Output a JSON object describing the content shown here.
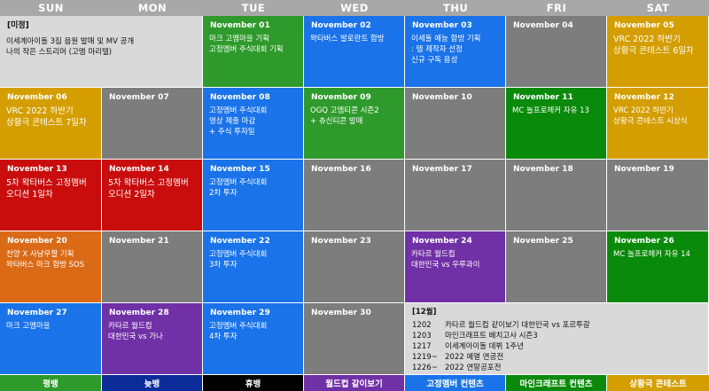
{
  "days": [
    "SUN",
    "MON",
    "TUE",
    "WED",
    "THU",
    "FRI",
    "SAT"
  ],
  "week1": {
    "sun_mon": {
      "label": "[미정]",
      "text": "이세계아이돌 3집 음원 발매 및 MV 공개\n나의 작은 스트리머 (고멤 마리텔)"
    },
    "tue": {
      "date": "November 01",
      "text": "마크 고멤마을 기획\n고정멤버 주식대회 기획"
    },
    "wed": {
      "date": "November 02",
      "text": "왁타버스 발로란트 합방"
    },
    "thu": {
      "date": "November 03",
      "text": "이세돌 예능 합방 기획\n: 템 제작자 선정\n신규 구독 용성"
    },
    "fri": {
      "date": "November 04",
      "text": ""
    },
    "sat": {
      "date": "November 05",
      "text": "VRC 2022 하반기\n상황극 콘테스트 6일차"
    }
  },
  "week2": {
    "sun": {
      "date": "November 06",
      "text": "VRC 2022 하반기\n상황극 콘테스트 7일차"
    },
    "mon": {
      "date": "November 07",
      "text": ""
    },
    "tue": {
      "date": "November 08",
      "text": "고정멤버 주식대회\n영상 제출 마감\n+ 주식 투자일"
    },
    "wed": {
      "date": "November 09",
      "text": "OGQ 고멤티콘 시즌2\n+ 츄신티콘 발매"
    },
    "thu": {
      "date": "November 10",
      "text": ""
    },
    "fri": {
      "date": "November 11",
      "text": "MC 놀프로헤커 자유 13"
    },
    "sat": {
      "date": "November 12",
      "text": "VRC 2022 하반기\n상황극 콘테스트 시상식"
    }
  },
  "week3": {
    "sun": {
      "date": "November 13",
      "text": "5차 왁타버스 고정멤버\n오디션 1일차"
    },
    "mon": {
      "date": "November 14",
      "text": "5차 왁타버스 고정멤버\n오디션 2일차"
    },
    "tue": {
      "date": "November 15",
      "text": "고정멤버 주식대회\n2차 투자"
    },
    "wed": {
      "date": "November 16",
      "text": ""
    },
    "thu": {
      "date": "November 17",
      "text": ""
    },
    "fri": {
      "date": "November 18",
      "text": ""
    },
    "sat": {
      "date": "November 19",
      "text": ""
    }
  },
  "week4": {
    "sun": {
      "date": "November 20",
      "text": "천양 X 사냥우짤 기획\n왁타버스 마크 합방 SOS"
    },
    "mon": {
      "date": "November 21",
      "text": ""
    },
    "tue": {
      "date": "November 22",
      "text": "고정멤버 주식대회\n3차 투자"
    },
    "wed": {
      "date": "November 23",
      "text": ""
    },
    "thu": {
      "date": "November 24",
      "text": "카타르 월드컵\n대한민국 vs 우루과이"
    },
    "fri": {
      "date": "November 25",
      "text": ""
    },
    "sat": {
      "date": "November 26",
      "text": "MC 놀프로헤커 자유 14"
    }
  },
  "week5": {
    "sun": {
      "date": "November 27",
      "text": "마크 고멤마을"
    },
    "mon": {
      "date": "November 28",
      "text": "카타르 월드컵\n대한민국 vs 가나"
    },
    "tue": {
      "date": "November 29",
      "text": "고정멤버 주식대회\n4차 투자"
    },
    "wed": {
      "date": "November 30",
      "text": ""
    }
  },
  "notes": {
    "title": "[12월]",
    "rows": [
      {
        "k": "1202",
        "v": "카타르 월드컵 같이보기 대한민국 vs 포르투갈"
      },
      {
        "k": "1203",
        "v": "마인크래프트 배치고사 시즌3"
      },
      {
        "k": "1217",
        "v": "이세계아이돌 데뷔 1주년"
      },
      {
        "k": "1219~",
        "v": "2022 예열 연공전"
      },
      {
        "k": "1226~",
        "v": "2022 연말공포전"
      }
    ]
  },
  "legend": [
    "평뱅",
    "늦뱅",
    "휴뱅",
    "월드컵 같이보기",
    "고정멤버 컨텐츠",
    "마인크래프트 컨텐츠",
    "상황극 콘테스트"
  ],
  "colors": {
    "header": "#a8a8a8",
    "gray": "#7d7d7d",
    "green": "#2e9a2b",
    "blue": "#1a73e8",
    "orange": "#db6a16",
    "red": "#c90d0d",
    "purple": "#7030a6",
    "yellow": "#d49e00",
    "light": "#d9d9d9",
    "dark_green": "#0a8a0a",
    "navy": "#0c2c9a",
    "black": "#000000"
  }
}
